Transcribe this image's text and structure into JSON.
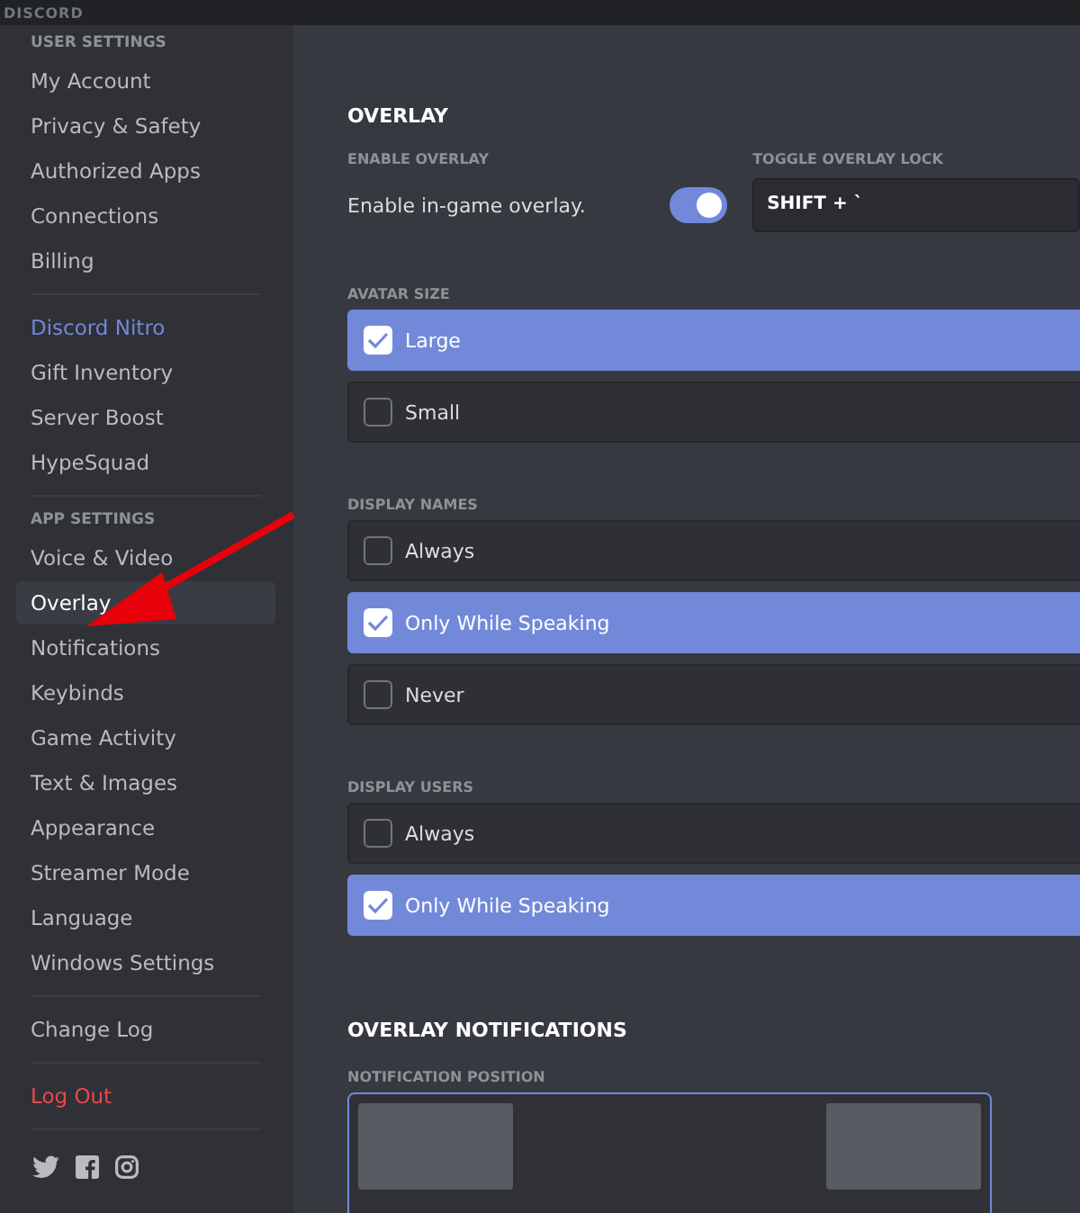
{
  "window": {
    "title": "DISCORD"
  },
  "sidebar": {
    "sections": [
      {
        "header": "USER SETTINGS",
        "items": [
          {
            "label": "My Account",
            "kind": "item",
            "selected": false
          },
          {
            "label": "Privacy & Safety",
            "kind": "item",
            "selected": false
          },
          {
            "label": "Authorized Apps",
            "kind": "item",
            "selected": false
          },
          {
            "label": "Connections",
            "kind": "item",
            "selected": false
          },
          {
            "label": "Billing",
            "kind": "item",
            "selected": false
          }
        ]
      },
      {
        "items": [
          {
            "label": "Discord Nitro",
            "kind": "nitro",
            "selected": false
          },
          {
            "label": "Gift Inventory",
            "kind": "item",
            "selected": false
          },
          {
            "label": "Server Boost",
            "kind": "item",
            "selected": false
          },
          {
            "label": "HypeSquad",
            "kind": "item",
            "selected": false
          }
        ]
      },
      {
        "header": "APP SETTINGS",
        "items": [
          {
            "label": "Voice & Video",
            "kind": "item",
            "selected": false
          },
          {
            "label": "Overlay",
            "kind": "item",
            "selected": true
          },
          {
            "label": "Notifications",
            "kind": "item",
            "selected": false
          },
          {
            "label": "Keybinds",
            "kind": "item",
            "selected": false
          },
          {
            "label": "Game Activity",
            "kind": "item",
            "selected": false
          },
          {
            "label": "Text & Images",
            "kind": "item",
            "selected": false
          },
          {
            "label": "Appearance",
            "kind": "item",
            "selected": false
          },
          {
            "label": "Streamer Mode",
            "kind": "item",
            "selected": false
          },
          {
            "label": "Language",
            "kind": "item",
            "selected": false
          },
          {
            "label": "Windows Settings",
            "kind": "item",
            "selected": false
          }
        ]
      },
      {
        "items": [
          {
            "label": "Change Log",
            "kind": "item",
            "selected": false
          }
        ]
      },
      {
        "items": [
          {
            "label": "Log Out",
            "kind": "danger",
            "selected": false
          }
        ]
      }
    ],
    "social": [
      {
        "kind": "twitter"
      },
      {
        "kind": "facebook"
      },
      {
        "kind": "instagram"
      }
    ]
  },
  "overlay": {
    "title": "OVERLAY",
    "enable_label": "ENABLE OVERLAY",
    "enable_text": "Enable in-game overlay.",
    "enabled": true,
    "lock_label": "TOGGLE OVERLAY LOCK",
    "lock_value": "SHIFT + `",
    "groups": [
      {
        "label": "AVATAR SIZE",
        "options": [
          {
            "label": "Large",
            "selected": true
          },
          {
            "label": "Small",
            "selected": false
          }
        ]
      },
      {
        "label": "DISPLAY NAMES",
        "options": [
          {
            "label": "Always",
            "selected": false
          },
          {
            "label": "Only While Speaking",
            "selected": true
          },
          {
            "label": "Never",
            "selected": false
          }
        ]
      },
      {
        "label": "DISPLAY USERS",
        "options": [
          {
            "label": "Always",
            "selected": false
          },
          {
            "label": "Only While Speaking",
            "selected": true
          }
        ]
      }
    ]
  },
  "notifications": {
    "title": "OVERLAY NOTIFICATIONS",
    "position_label": "NOTIFICATION POSITION"
  }
}
